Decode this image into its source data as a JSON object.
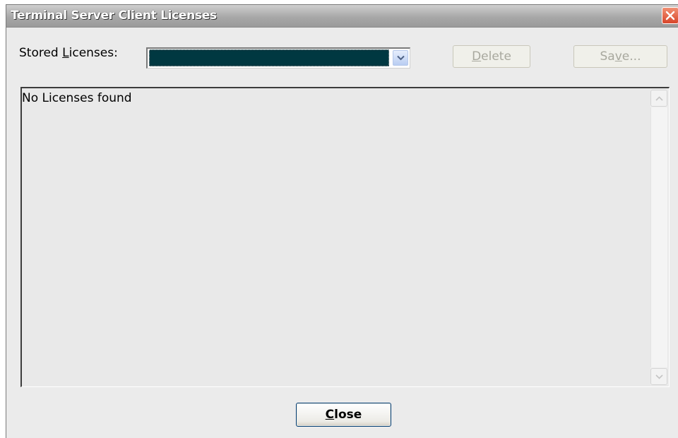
{
  "window": {
    "title": "Terminal Server Client Licenses"
  },
  "stored_licenses": {
    "label_pre": "Stored ",
    "label_accel": "L",
    "label_post": "icenses:",
    "selected_value": ""
  },
  "buttons": {
    "delete_accel": "D",
    "delete_rest": "elete",
    "save_pre": "Sa",
    "save_accel": "v",
    "save_post": "e...",
    "close_accel": "C",
    "close_rest": "lose"
  },
  "license_list": {
    "empty_text": "No Licenses found"
  },
  "icons": {
    "close": "close-icon",
    "dropdown": "chevron-down-icon",
    "scroll_up": "scroll-up-arrow-icon",
    "scroll_down": "scroll-down-arrow-icon"
  },
  "colors": {
    "combo_selection": "#003841",
    "close_button": "#d8452a",
    "dialog_bg": "#ebebeb"
  }
}
